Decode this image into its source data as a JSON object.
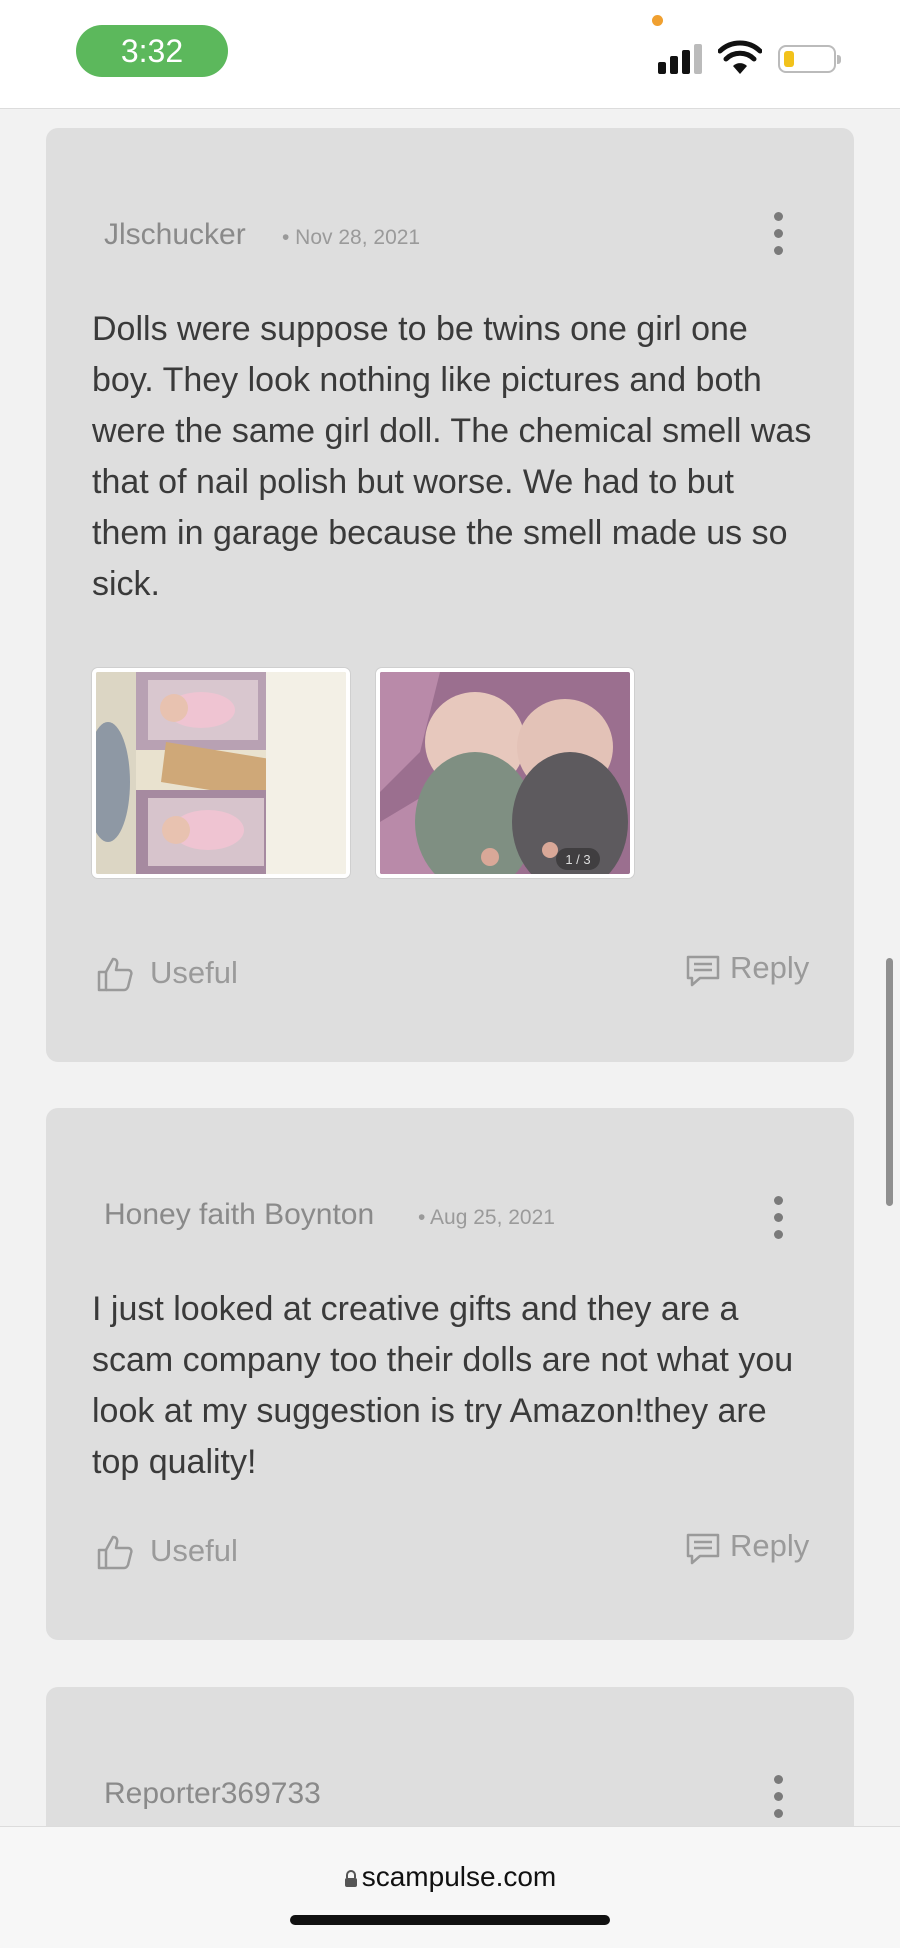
{
  "status_bar": {
    "time": "3:32"
  },
  "reviews": [
    {
      "author": "Jlschucker",
      "date": "• Nov 28, 2021",
      "text": "Dolls were suppose to be twins one girl one boy. They look nothing like pictures and both were the same girl doll. The chemical smell was that of nail polish but worse. We had to but them in garage because the smell made us so sick.",
      "photo_counter": "1 / 3",
      "useful_label": "Useful",
      "reply_label": "Reply"
    },
    {
      "author": "Honey faith Boynton",
      "date": "• Aug 25, 2021",
      "text": "I just looked at creative gifts and they are a scam company too their dolls are not what you look at my suggestion is try Amazon!they are top quality!",
      "useful_label": "Useful",
      "reply_label": "Reply"
    },
    {
      "author": "Reporter369733"
    }
  ],
  "browser": {
    "url": "scampulse.com"
  },
  "icons": {
    "signal": "cellular-signal-icon",
    "wifi": "wifi-icon",
    "battery": "battery-icon",
    "menu": "more-vertical-icon",
    "useful": "thumbs-up-icon",
    "reply": "comment-icon",
    "lock": "lock-icon"
  },
  "colors": {
    "status_time_pill": "#5cb85c",
    "card_background": "#dedede",
    "page_background": "#f2f2f2",
    "battery_fill": "#f2c21b"
  }
}
